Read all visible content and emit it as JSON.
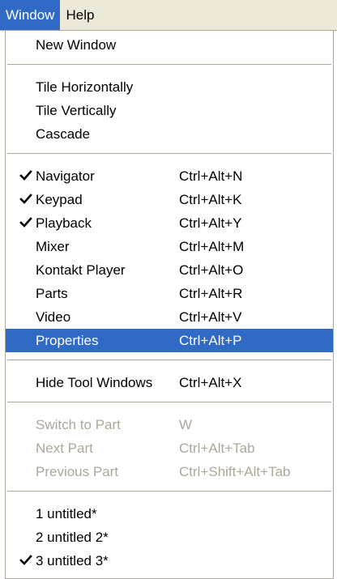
{
  "menubar": {
    "items": [
      {
        "label": "Window",
        "active": true
      },
      {
        "label": "Help",
        "active": false
      }
    ]
  },
  "menu": {
    "groups": [
      [
        {
          "label": "New Window",
          "shortcut": "",
          "checked": false,
          "disabled": false,
          "highlighted": false
        }
      ],
      [
        {
          "label": "Tile Horizontally",
          "shortcut": "",
          "checked": false,
          "disabled": false,
          "highlighted": false
        },
        {
          "label": "Tile Vertically",
          "shortcut": "",
          "checked": false,
          "disabled": false,
          "highlighted": false
        },
        {
          "label": "Cascade",
          "shortcut": "",
          "checked": false,
          "disabled": false,
          "highlighted": false
        }
      ],
      [
        {
          "label": "Navigator",
          "shortcut": "Ctrl+Alt+N",
          "checked": true,
          "disabled": false,
          "highlighted": false
        },
        {
          "label": "Keypad",
          "shortcut": "Ctrl+Alt+K",
          "checked": true,
          "disabled": false,
          "highlighted": false
        },
        {
          "label": "Playback",
          "shortcut": "Ctrl+Alt+Y",
          "checked": true,
          "disabled": false,
          "highlighted": false
        },
        {
          "label": "Mixer",
          "shortcut": "Ctrl+Alt+M",
          "checked": false,
          "disabled": false,
          "highlighted": false
        },
        {
          "label": "Kontakt Player",
          "shortcut": "Ctrl+Alt+O",
          "checked": false,
          "disabled": false,
          "highlighted": false
        },
        {
          "label": "Parts",
          "shortcut": "Ctrl+Alt+R",
          "checked": false,
          "disabled": false,
          "highlighted": false
        },
        {
          "label": "Video",
          "shortcut": "Ctrl+Alt+V",
          "checked": false,
          "disabled": false,
          "highlighted": false
        },
        {
          "label": "Properties",
          "shortcut": "Ctrl+Alt+P",
          "checked": false,
          "disabled": false,
          "highlighted": true
        }
      ],
      [
        {
          "label": "Hide Tool Windows",
          "shortcut": "Ctrl+Alt+X",
          "checked": false,
          "disabled": false,
          "highlighted": false
        }
      ],
      [
        {
          "label": "Switch to Part",
          "shortcut": "W",
          "checked": false,
          "disabled": true,
          "highlighted": false
        },
        {
          "label": "Next Part",
          "shortcut": "Ctrl+Alt+Tab",
          "checked": false,
          "disabled": true,
          "highlighted": false
        },
        {
          "label": "Previous Part",
          "shortcut": "Ctrl+Shift+Alt+Tab",
          "checked": false,
          "disabled": true,
          "highlighted": false
        }
      ],
      [
        {
          "label": "1 untitled*",
          "shortcut": "",
          "checked": false,
          "disabled": false,
          "highlighted": false
        },
        {
          "label": "2 untitled 2*",
          "shortcut": "",
          "checked": false,
          "disabled": false,
          "highlighted": false
        },
        {
          "label": "3 untitled 3*",
          "shortcut": "",
          "checked": true,
          "disabled": false,
          "highlighted": false
        }
      ]
    ]
  },
  "colors": {
    "highlight": "#316ac5",
    "disabled_text": "#aca899",
    "menubar_bg": "#ece9d8"
  },
  "icons": {
    "check": "check-mark-icon"
  }
}
